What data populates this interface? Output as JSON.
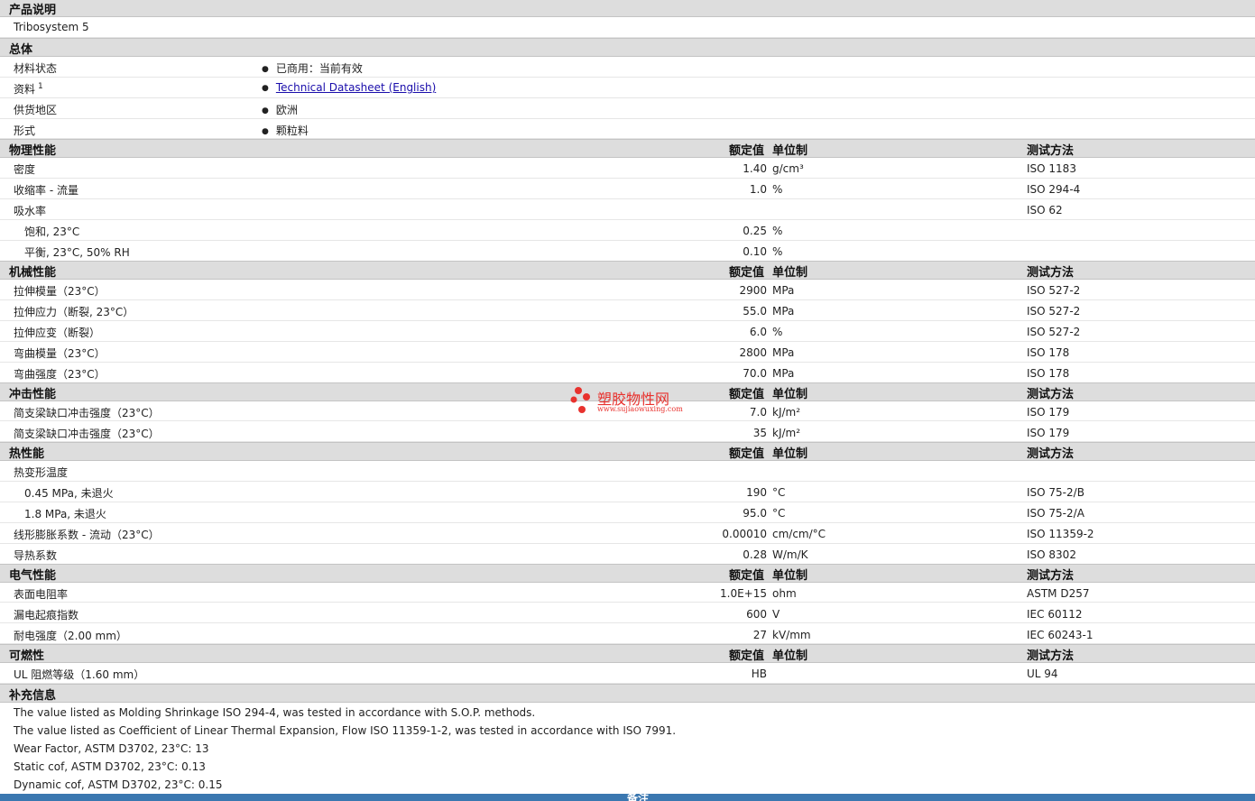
{
  "product": {
    "section_title": "产品说明",
    "name": "Tribosystem 5"
  },
  "general": {
    "section_title": "总体",
    "rows": [
      {
        "label": "材料状态",
        "value": "已商用：当前有效"
      },
      {
        "label": "资料",
        "sup": "1",
        "value": "Technical Datasheet (English)"
      },
      {
        "label": "供货地区",
        "value": "欧洲"
      },
      {
        "label": "形式",
        "value": "颗粒料"
      }
    ]
  },
  "headers": {
    "value": "额定值",
    "unit": "单位制",
    "method": "测试方法"
  },
  "physical": {
    "section_title": "物理性能",
    "rows": [
      {
        "label": "密度",
        "value": "1.40",
        "unit": "g/cm³",
        "method": "ISO 1183"
      },
      {
        "label": "收缩率 - 流量",
        "value": "1.0",
        "unit": "%",
        "method": "ISO 294-4"
      },
      {
        "label": "吸水率",
        "value": "",
        "unit": "",
        "method": "ISO 62"
      },
      {
        "label": "饱和, 23°C",
        "value": "0.25",
        "unit": "%",
        "method": ""
      },
      {
        "label": "平衡, 23°C, 50% RH",
        "value": "0.10",
        "unit": "%",
        "method": ""
      }
    ]
  },
  "mechanical": {
    "section_title": "机械性能",
    "rows": [
      {
        "label": "拉伸模量（23°C）",
        "value": "2900",
        "unit": "MPa",
        "method": "ISO 527-2"
      },
      {
        "label": "拉伸应力（断裂, 23°C）",
        "value": "55.0",
        "unit": "MPa",
        "method": "ISO 527-2"
      },
      {
        "label": "拉伸应变（断裂）",
        "value": "6.0",
        "unit": "%",
        "method": "ISO 527-2"
      },
      {
        "label": "弯曲模量（23°C）",
        "value": "2800",
        "unit": "MPa",
        "method": "ISO 178"
      },
      {
        "label": "弯曲强度（23°C）",
        "value": "70.0",
        "unit": "MPa",
        "method": "ISO 178"
      }
    ]
  },
  "impact": {
    "section_title": "冲击性能",
    "rows": [
      {
        "label": "简支梁缺口冲击强度（23°C）",
        "value": "7.0",
        "unit": "kJ/m²",
        "method": "ISO 179"
      },
      {
        "label": "简支梁缺口冲击强度（23°C）",
        "value": "35",
        "unit": "kJ/m²",
        "method": "ISO 179"
      }
    ]
  },
  "thermal": {
    "section_title": "热性能",
    "rows": [
      {
        "label": "热变形温度",
        "value": "",
        "unit": "",
        "method": ""
      },
      {
        "label": "0.45 MPa, 未退火",
        "value": "190",
        "unit": "°C",
        "method": "ISO 75-2/B"
      },
      {
        "label": "1.8 MPa, 未退火",
        "value": "95.0",
        "unit": "°C",
        "method": "ISO 75-2/A"
      },
      {
        "label": "线形膨胀系数 - 流动（23°C）",
        "value": "0.00010",
        "unit": "cm/cm/°C",
        "method": "ISO 11359-2"
      },
      {
        "label": "导热系数",
        "value": "0.28",
        "unit": "W/m/K",
        "method": "ISO 8302"
      }
    ]
  },
  "electrical": {
    "section_title": "电气性能",
    "rows": [
      {
        "label": "表面电阻率",
        "value": "1.0E+15",
        "unit": "ohm",
        "method": "ASTM D257"
      },
      {
        "label": "漏电起痕指数",
        "value": "600",
        "unit": "V",
        "method": "IEC 60112"
      },
      {
        "label": "耐电强度（2.00 mm）",
        "value": "27",
        "unit": "kV/mm",
        "method": "IEC 60243-1"
      }
    ]
  },
  "flammability": {
    "section_title": "可燃性",
    "rows": [
      {
        "label": "UL 阻燃等级（1.60 mm）",
        "value": "HB",
        "unit": "",
        "method": "UL 94"
      }
    ]
  },
  "supplemental": {
    "section_title": "补充信息",
    "notes": [
      "The value listed as Molding Shrinkage ISO 294-4, was tested in accordance with S.O.P. methods.",
      "The value listed as Coefficient of Linear Thermal Expansion, Flow ISO 11359-1-2, was tested in accordance with ISO 7991.",
      "Wear Factor, ASTM D3702, 23°C: 13",
      "Static cof, ASTM D3702, 23°C: 0.13",
      "Dynamic cof, ASTM D3702, 23°C: 0.15"
    ]
  },
  "footer": {
    "label": "备注"
  },
  "watermark": {
    "name": "塑胶物性网",
    "url": "www.sujiaowuxing.com",
    "color": "#e8322e"
  },
  "colors": {
    "section_bg": "#dddddd",
    "footer_bar": "#3a77b0",
    "link": "#1a0dab"
  }
}
